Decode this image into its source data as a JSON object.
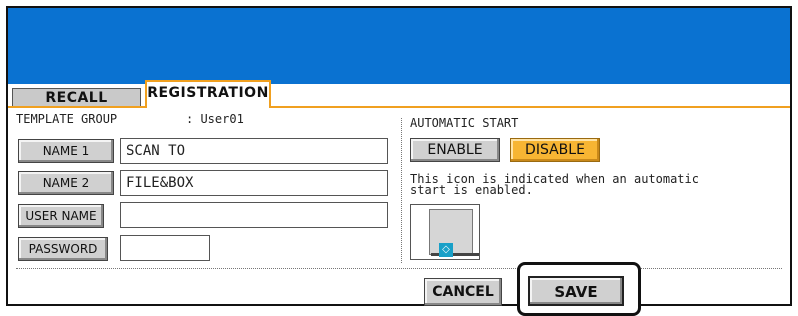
{
  "tabs": [
    {
      "label": "RECALL",
      "active": false
    },
    {
      "label": "REGISTRATION",
      "active": true
    }
  ],
  "template_group": {
    "label": "TEMPLATE GROUP",
    "value": ": User01"
  },
  "fields": {
    "name1": {
      "button": "NAME 1",
      "value": "SCAN TO"
    },
    "name2": {
      "button": "NAME 2",
      "value": "FILE&BOX"
    },
    "user_name": {
      "button": "USER NAME",
      "value": ""
    },
    "password": {
      "button": "PASSWORD",
      "value": ""
    }
  },
  "automatic_start": {
    "heading": "AUTOMATIC START",
    "enable_label": "ENABLE",
    "disable_label": "DISABLE",
    "selected": "DISABLE",
    "description_line1": "This icon is indicated when an automatic",
    "description_line2": "start is enabled.",
    "icon": "template-start-icon"
  },
  "footer": {
    "cancel_label": "CANCEL",
    "save_label": "SAVE"
  },
  "colors": {
    "header": "#0a72d1",
    "accent": "#f0a020",
    "selected_button": "#f7b533"
  }
}
